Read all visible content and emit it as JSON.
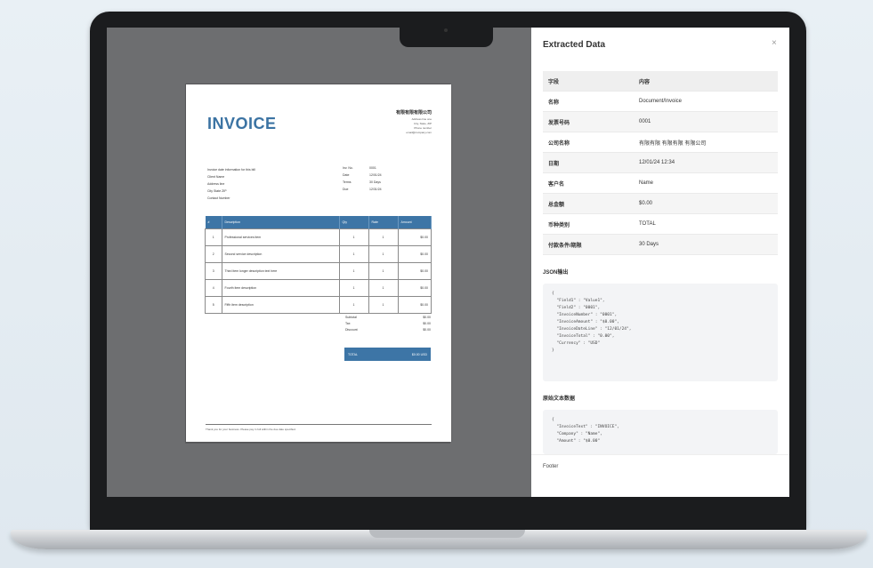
{
  "invoice": {
    "title": "INVOICE",
    "company_name": "有限有限有限公司",
    "company_lines": [
      "Address line one",
      "City, State, ZIP",
      "Phone number",
      "email@company.com"
    ],
    "bill_to": [
      "Invoice date information for this bill",
      "Client Name",
      "Address line",
      "City State ZIP",
      "Contact Number"
    ],
    "meta": [
      {
        "label": "Inv. No.",
        "value": "0001"
      },
      {
        "label": "Date",
        "value": "12/01/24"
      },
      {
        "label": "Terms",
        "value": "30 Days"
      },
      {
        "label": "Due",
        "value": "12/31/24"
      }
    ],
    "columns": [
      "#",
      "Description",
      "Qty",
      "Rate",
      "Amount"
    ],
    "rows": [
      {
        "no": "1",
        "desc": "Professional services item",
        "qty": "1",
        "rate": "1",
        "amount": "$0.00"
      },
      {
        "no": "2",
        "desc": "Second service description",
        "qty": "1",
        "rate": "1",
        "amount": "$0.00"
      },
      {
        "no": "3",
        "desc": "Third item longer description text here",
        "qty": "1",
        "rate": "1",
        "amount": "$0.00"
      },
      {
        "no": "4",
        "desc": "Fourth item description",
        "qty": "1",
        "rate": "1",
        "amount": "$0.00"
      },
      {
        "no": "5",
        "desc": "Fifth item description",
        "qty": "1",
        "rate": "1",
        "amount": "$0.00"
      }
    ],
    "totals": [
      {
        "label": "Subtotal",
        "value": "$0.00"
      },
      {
        "label": "Tax",
        "value": "$0.00"
      },
      {
        "label": "Discount",
        "value": "$0.00"
      }
    ],
    "total_label": "TOTAL",
    "total_value": "$0.00 USD",
    "footer_text": "Thank you for your business. Please pay in full within the due date specified."
  },
  "panel": {
    "title": "Extracted Data",
    "close_glyph": "×",
    "header": {
      "k": "字段",
      "v": "内容"
    },
    "fields": [
      {
        "k": "名称",
        "v": "Document/Invoice"
      },
      {
        "k": "发票号码",
        "v": "0001"
      },
      {
        "k": "公司名称",
        "v": "有限有限 有限有限 有限公司"
      },
      {
        "k": "日期",
        "v": "12/01/24 12:34"
      },
      {
        "k": "客户名",
        "v": "Name"
      },
      {
        "k": "总金额",
        "v": "$0.00"
      },
      {
        "k": "币种类别",
        "v": "TOTAL"
      },
      {
        "k": "付款条件/期限",
        "v": "30 Days"
      }
    ],
    "json_title": "JSON输出",
    "json_code": "{\n  \"Field1\" : \"Value1\",\n  \"Field2\" : \"0001\",\n  \"InvoiceNumber\" : \"0001\",\n  \"InvoiceAmount\" : \"$0.00\",\n  \"InvoiceDateLine\" : \"12/01/24\",\n  \"InvoiceTotal\" : \"0.00\",\n  \"Currency\" : \"USD\"\n}",
    "raw_title": "原始文本数据",
    "raw_code": "{\n  \"InvoiceText\" : \"INVOICE\",\n  \"Company\" : \"Name\",\n  \"Amount\" : \"$0.00\"",
    "footer_label": "Footer"
  }
}
